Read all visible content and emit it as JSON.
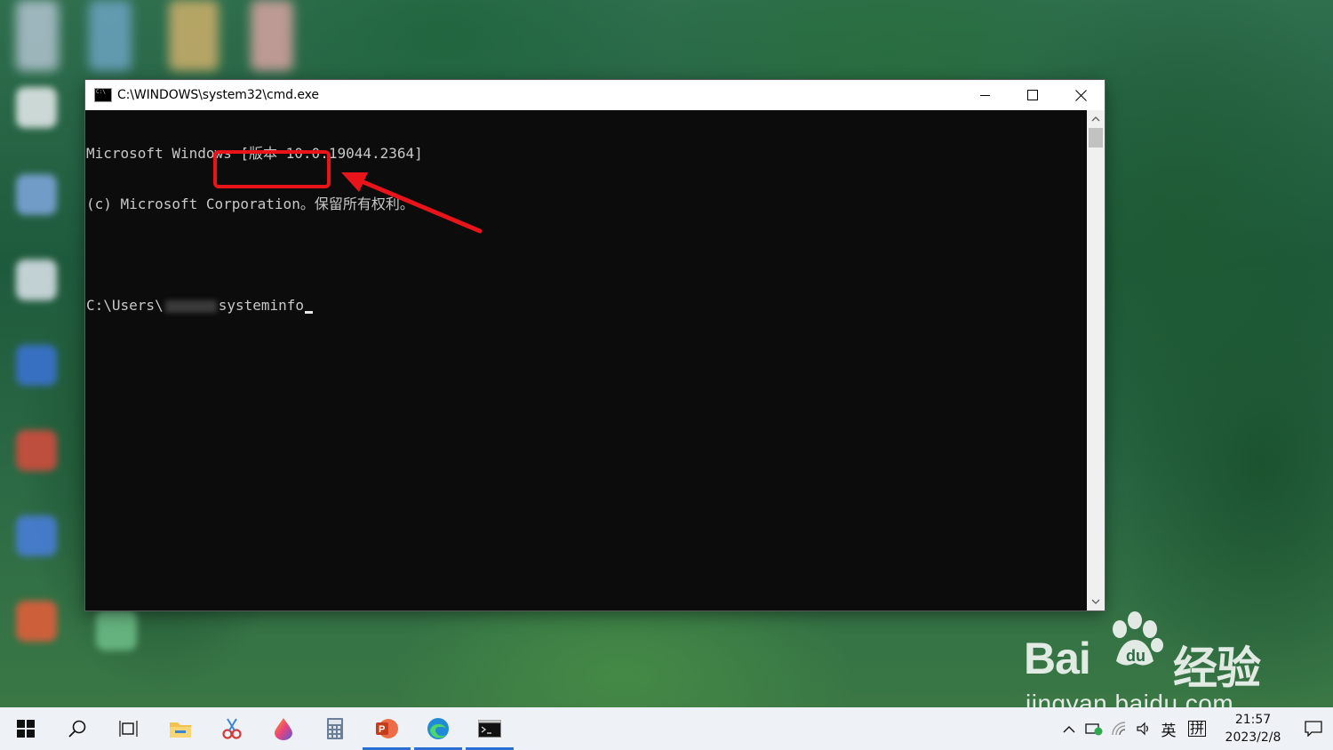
{
  "window": {
    "title": "C:\\WINDOWS\\system32\\cmd.exe",
    "minimize_label": "—",
    "maximize_label": "□",
    "close_label": "✕"
  },
  "console": {
    "line1": "Microsoft Windows [版本 10.0.19044.2364]",
    "line2": "(c) Microsoft Corporation。保留所有权利。",
    "prompt_prefix": "C:\\Users\\",
    "command": "systeminfo"
  },
  "annotation": {
    "color": "#e8141a"
  },
  "watermark": {
    "brand_left": "Bai",
    "brand_right": "经验",
    "url": "jingyan.baidu.com"
  },
  "taskbar": {
    "apps": [
      "start",
      "search",
      "task-view",
      "file-explorer",
      "snipping-tool",
      "paint",
      "calculator",
      "powerpoint",
      "edge",
      "command-prompt"
    ],
    "active_apps": [
      "powerpoint",
      "edge",
      "command-prompt"
    ],
    "tray": {
      "ime_lang": "英",
      "ime_mode": "拼",
      "time": "21:57",
      "date": "2023/2/8"
    }
  },
  "colors": {
    "accent": "#2a6fd6",
    "console_bg": "#0c0c0c",
    "console_fg": "#c8c8c8"
  }
}
